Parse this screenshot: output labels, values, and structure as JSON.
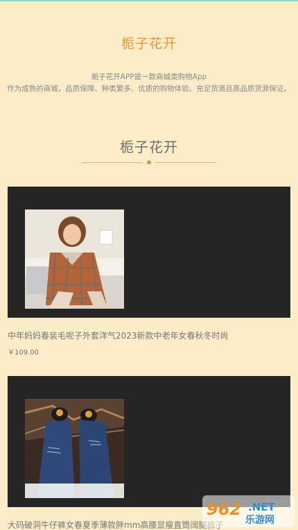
{
  "header": {
    "app_title": "栀子花开",
    "desc_line1": "栀子花开APP是一款商城类购物App",
    "desc_line2": "作为成熟的商城，品质保障、种类繁多、优质的购物体验。充足货源且高品质货源保证。"
  },
  "section": {
    "title": "栀子花开"
  },
  "products": [
    {
      "name": "中年妈妈春装毛呢子外套洋气2023新款中老年女春秋冬时尚",
      "price": "￥109.00"
    },
    {
      "name": "大码破洞牛仔裤女春夏季薄款胖mm高腰显瘦直筒阔腿裤子",
      "price": ""
    }
  ],
  "watermark": {
    "number": "962",
    "domain": ".NET",
    "site": "乐游网"
  },
  "colors": {
    "background": "#fdecc8",
    "accent": "#e8963a",
    "card_dark": "#252525"
  }
}
